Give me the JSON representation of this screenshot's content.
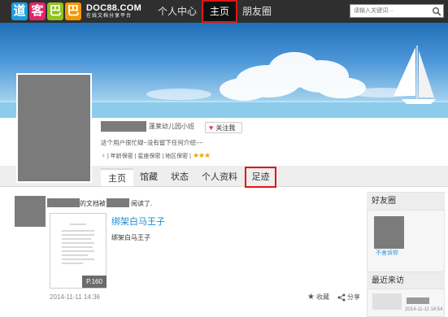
{
  "topbar": {
    "logo_chars": [
      "道",
      "客",
      "巴",
      "巴"
    ],
    "logo_colors": [
      "#1f9de0",
      "#e2266b",
      "#8fc31f",
      "#f39800"
    ],
    "logo_domain": "DOC88.COM",
    "logo_slogan": "在线文档分享平台",
    "nav": [
      "个人中心",
      "主页",
      "朋友圈"
    ],
    "nav_active_index": 1,
    "search_placeholder": "请输入关键词···"
  },
  "profile": {
    "school": "蓬莱幼儿园小班",
    "follow_label": "关注我",
    "signature": "这个用户很忙碌~没有留下任何介绍~~",
    "tags": "| 年龄保密 | 星座保密 | 地区保密 |",
    "stars": "★★★",
    "gender_icon": "female-icon"
  },
  "tabs": [
    "主页",
    "馆藏",
    "状态",
    "个人资料",
    "足迹"
  ],
  "tabs_active_index": 0,
  "tabs_highlight_index": 4,
  "feed": {
    "text1": "的文档被",
    "text2": "阅读了.",
    "doc_title": "绑架白马王子",
    "doc_desc": "绑架白马王子",
    "doc_pages": "P.160",
    "time": "2014-11-11 14:36",
    "favorite_label": "收藏",
    "share_label": "分享"
  },
  "sidebar": {
    "friends_heading": "好友圈",
    "friend_name": "不舍诉你",
    "recent_heading": "最近来访",
    "recent_date": "2014-11-11 14:54"
  },
  "colors": {
    "topbar_bg": "#2f2f2f",
    "active_outline": "#e01515",
    "link_blue": "#1c8dd0",
    "sky_top": "#1f6fb8",
    "placeholder_gray": "#7b7b7b"
  }
}
